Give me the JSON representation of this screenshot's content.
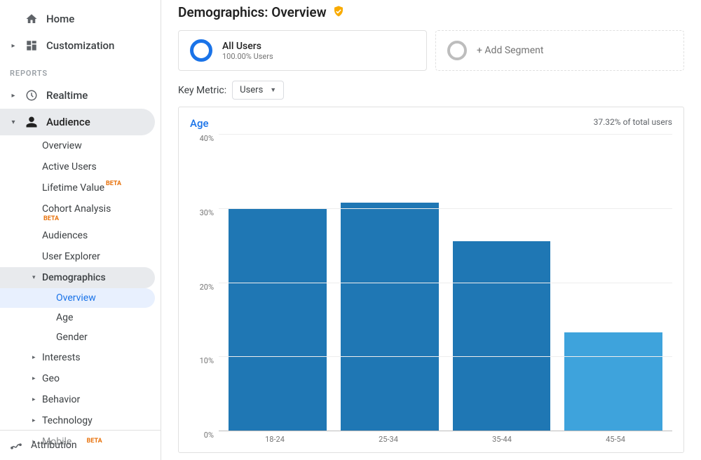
{
  "sidebar": {
    "home": "Home",
    "customization": "Customization",
    "reports_header": "REPORTS",
    "realtime": "Realtime",
    "audience": "Audience",
    "audience_children": {
      "overview": "Overview",
      "active_users": "Active Users",
      "lifetime_value": "Lifetime Value",
      "cohort_analysis": "Cohort Analysis",
      "audiences": "Audiences",
      "user_explorer": "User Explorer",
      "demographics": "Demographics",
      "demographics_children": {
        "overview": "Overview",
        "age": "Age",
        "gender": "Gender"
      },
      "interests": "Interests",
      "geo": "Geo",
      "behavior": "Behavior",
      "technology": "Technology",
      "mobile": "Mobile"
    },
    "attribution": "Attribution"
  },
  "badges": {
    "beta": "BETA"
  },
  "page": {
    "title": "Demographics: Overview"
  },
  "segments": {
    "all_users": {
      "title": "All Users",
      "subtitle": "100.00% Users"
    },
    "add": {
      "label": "+ Add Segment"
    }
  },
  "key_metric": {
    "label": "Key Metric:",
    "value": "Users"
  },
  "chart": {
    "title": "Age",
    "note": "37.32% of total users"
  },
  "chart_data": {
    "type": "bar",
    "title": "Age",
    "xlabel": "",
    "ylabel": "",
    "categories": [
      "18-24",
      "25-34",
      "35-44",
      "45-54"
    ],
    "values": [
      30.0,
      30.7,
      25.5,
      13.2
    ],
    "ylim": [
      0,
      40
    ],
    "y_ticks": [
      "40%",
      "30%",
      "20%",
      "10%",
      "0%"
    ],
    "highlight_index": 3
  }
}
